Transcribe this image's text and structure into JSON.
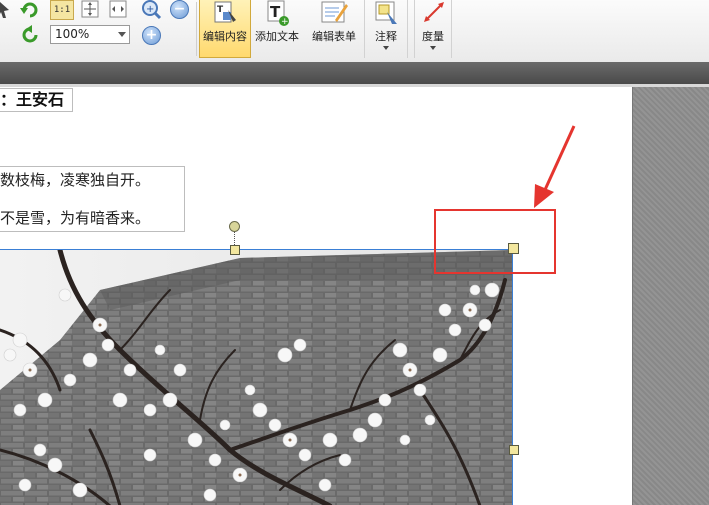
{
  "toolbar": {
    "zoom_level": "100%",
    "actual_size_label": "1:1",
    "buttons": {
      "edit_content": "编辑内容",
      "add_text": "添加文本",
      "edit_form": "编辑表单",
      "annotate": "注释",
      "measure": "度量"
    },
    "active_button_color": "#ffd96e"
  },
  "document": {
    "author": "：王安石",
    "poem_lines": [
      "数枝梅，凌寒独自开。",
      "不是雪，为有暗香来。"
    ],
    "image": {
      "subject": "white plum blossoms in front of a grey brick wall"
    }
  },
  "annotation": {
    "color": "#e5352f"
  }
}
